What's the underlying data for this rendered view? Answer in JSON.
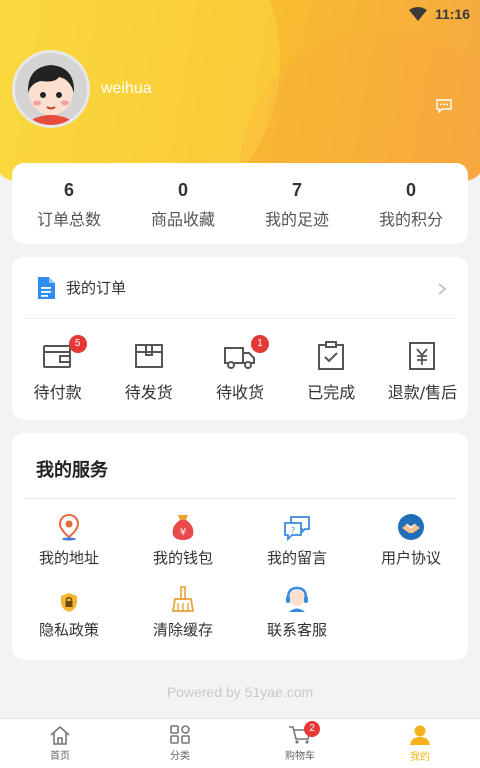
{
  "status_bar": {
    "time": "11:16",
    "wifi_icon": "wifi-icon",
    "battery_icon": "battery-icon"
  },
  "profile": {
    "username": "weihua",
    "avatar_icon": "cartoon-avatar",
    "message_icon": "chat-bubble-icon"
  },
  "stats": [
    {
      "value": "6",
      "label": "订单总数"
    },
    {
      "value": "0",
      "label": "商品收藏"
    },
    {
      "value": "7",
      "label": "我的足迹"
    },
    {
      "value": "0",
      "label": "我的积分"
    }
  ],
  "orders": {
    "title": "我的订单",
    "items": [
      {
        "label": "待付款",
        "badge": "5",
        "icon": "wallet-icon"
      },
      {
        "label": "待发货",
        "badge": "",
        "icon": "box-icon"
      },
      {
        "label": "待收货",
        "badge": "1",
        "icon": "truck-icon"
      },
      {
        "label": "已完成",
        "badge": "",
        "icon": "clipboard-check-icon"
      },
      {
        "label": "退款/售后",
        "badge": "",
        "icon": "refund-icon"
      }
    ]
  },
  "services": {
    "title": "我的服务",
    "items": [
      {
        "label": "我的地址",
        "icon": "location-pin-icon"
      },
      {
        "label": "我的钱包",
        "icon": "money-bag-icon"
      },
      {
        "label": "我的留言",
        "icon": "message-icon"
      },
      {
        "label": "用户协议",
        "icon": "handshake-icon"
      },
      {
        "label": "隐私政策",
        "icon": "lock-shield-icon"
      },
      {
        "label": "清除缓存",
        "icon": "broom-icon"
      },
      {
        "label": "联系客服",
        "icon": "customer-service-icon"
      }
    ]
  },
  "footer": {
    "powered_by": "Powered by 51yae.com"
  },
  "tabbar": {
    "items": [
      {
        "label": "首页",
        "icon": "home-icon"
      },
      {
        "label": "分类",
        "icon": "category-icon"
      },
      {
        "label": "购物车",
        "icon": "cart-icon",
        "badge": "2"
      },
      {
        "label": "我的",
        "icon": "user-icon",
        "active": true
      }
    ]
  },
  "colors": {
    "accent": "#f6b21c",
    "header_start": "#f7d233",
    "header_end": "#f6a842",
    "badge": "#e53935"
  }
}
